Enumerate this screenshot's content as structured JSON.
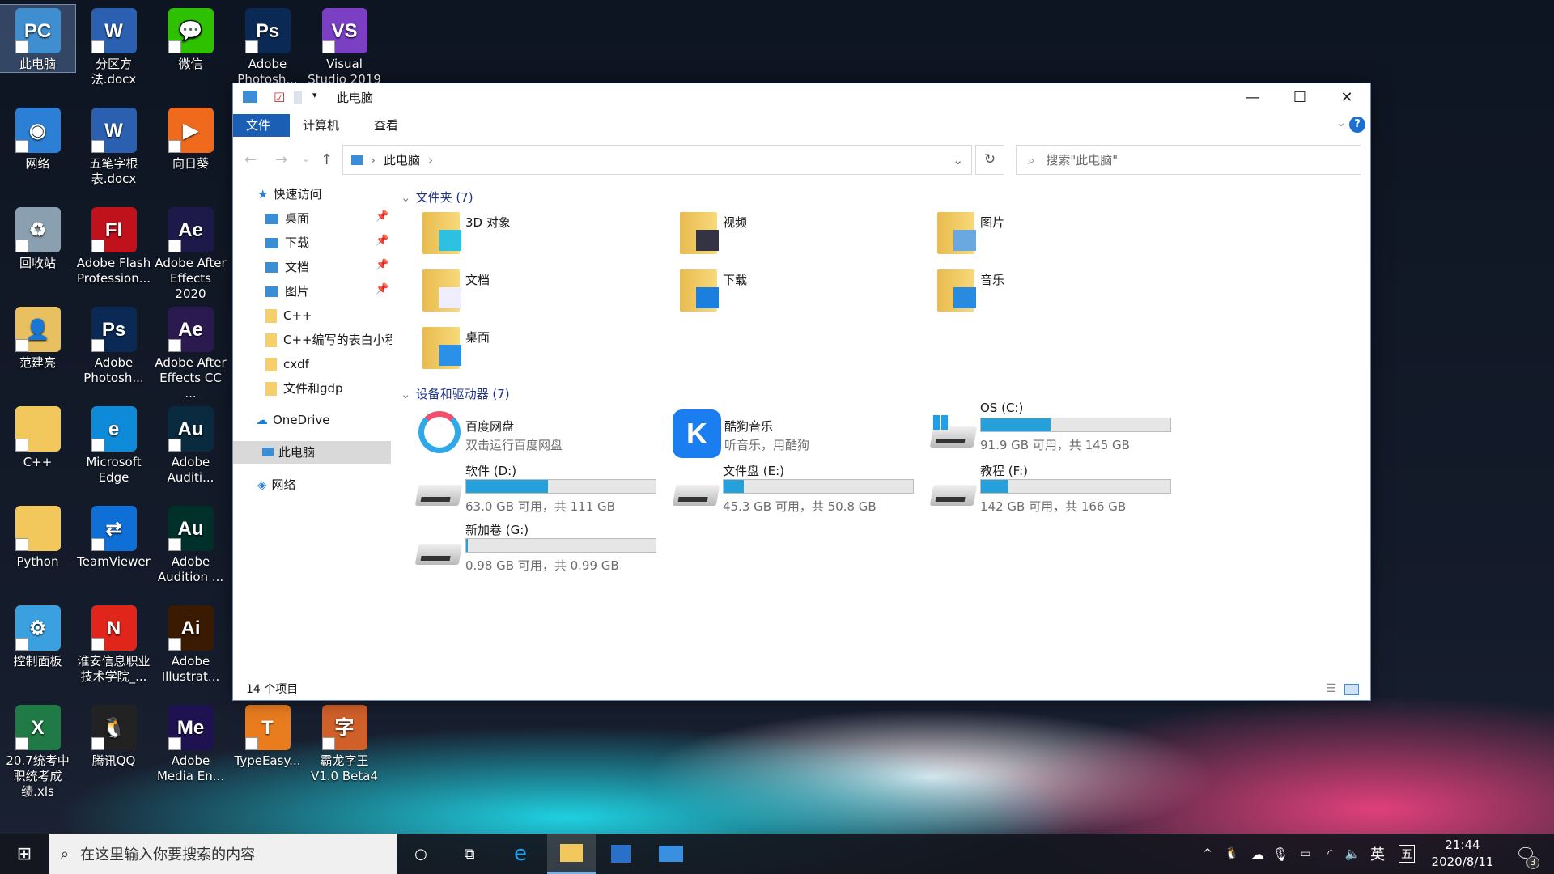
{
  "desktop": {
    "icons": [
      {
        "label": "此电脑",
        "abbr": "PC",
        "color": "#3f8fd0",
        "selected": true
      },
      {
        "label": "网络",
        "abbr": "◉",
        "color": "#2b7fd4"
      },
      {
        "label": "回收站",
        "abbr": "♻",
        "color": "#8aa0b0"
      },
      {
        "label": "范建亮",
        "abbr": "👤",
        "color": "#e8c060"
      },
      {
        "label": "C++",
        "abbr": "",
        "color": "#f2c75c"
      },
      {
        "label": "Python",
        "abbr": "",
        "color": "#f2c75c"
      },
      {
        "label": "控制面板",
        "abbr": "⚙",
        "color": "#3aa0e0"
      },
      {
        "label": "20.7统考中职统考成绩.xls",
        "abbr": "X",
        "color": "#1f7a45"
      },
      {
        "label": "分区方法.docx",
        "abbr": "W",
        "color": "#2b5fb0"
      },
      {
        "label": "五笔字根表.docx",
        "abbr": "W",
        "color": "#2b5fb0"
      },
      {
        "label": "Adobe Flash Profession...",
        "abbr": "Fl",
        "color": "#c0121b"
      },
      {
        "label": "Adobe Photosh...",
        "abbr": "Ps",
        "color": "#0a2a55"
      },
      {
        "label": "Microsoft Edge",
        "abbr": "e",
        "color": "#0d8ad8"
      },
      {
        "label": "TeamViewer",
        "abbr": "⇄",
        "color": "#0e6fd6"
      },
      {
        "label": "淮安信息职业技术学院_...",
        "abbr": "N",
        "color": "#e0251b"
      },
      {
        "label": "腾讯QQ",
        "abbr": "🐧",
        "color": "#222"
      },
      {
        "label": "微信",
        "abbr": "💬",
        "color": "#2dc100"
      },
      {
        "label": "向日葵",
        "abbr": "▶",
        "color": "#f06a1e"
      },
      {
        "label": "Adobe After Effects 2020",
        "abbr": "Ae",
        "color": "#1d1a4a"
      },
      {
        "label": "Adobe After Effects CC ...",
        "abbr": "Ae",
        "color": "#2a1a50"
      },
      {
        "label": "Adobe Auditi...",
        "abbr": "Au",
        "color": "#0a2a40"
      },
      {
        "label": "Adobe Audition ...",
        "abbr": "Au",
        "color": "#00302a"
      },
      {
        "label": "Adobe Illustrat...",
        "abbr": "Ai",
        "color": "#3a1a00"
      },
      {
        "label": "Adobe Media En...",
        "abbr": "Me",
        "color": "#1e1250"
      },
      {
        "label": "Adobe Photosh...",
        "abbr": "Ps",
        "color": "#0a2a55"
      },
      {
        "label": "TypeEasy...",
        "abbr": "T",
        "color": "#e87c1e"
      },
      {
        "label": "Visual Studio 2019",
        "abbr": "VS",
        "color": "#7b3fc4"
      },
      {
        "label": "霸龙字王V1.0 Beta4",
        "abbr": "字",
        "color": "#d0602a"
      }
    ]
  },
  "explorer": {
    "title": "此电脑",
    "ribbon_tabs": [
      "文件",
      "计算机",
      "查看"
    ],
    "address": {
      "path": "此电脑"
    },
    "search": {
      "placeholder": "搜索\"此电脑\""
    },
    "nav": {
      "quick_access": "快速访问",
      "quick_items": [
        {
          "label": "桌面",
          "pinned": true
        },
        {
          "label": "下载",
          "pinned": true
        },
        {
          "label": "文档",
          "pinned": true
        },
        {
          "label": "图片",
          "pinned": true
        },
        {
          "label": "C++"
        },
        {
          "label": "C++编写的表白小程"
        },
        {
          "label": "cxdf"
        },
        {
          "label": "文件和gdp"
        }
      ],
      "onedrive": "OneDrive",
      "this_pc": "此电脑",
      "network": "网络"
    },
    "folders_header": "文件夹 (7)",
    "folders": [
      "3D 对象",
      "视频",
      "图片",
      "文档",
      "下载",
      "音乐",
      "桌面"
    ],
    "devices_header": "设备和驱动器 (7)",
    "apps": [
      {
        "name": "百度网盘",
        "desc": "双击运行百度网盘"
      },
      {
        "name": "酷狗音乐",
        "desc": "听音乐，用酷狗"
      }
    ],
    "drives": [
      {
        "name": "OS (C:)",
        "info": "91.9 GB 可用，共 145 GB",
        "used_pct": 36.6
      },
      {
        "name": "软件 (D:)",
        "info": "63.0 GB 可用，共 111 GB",
        "used_pct": 43.2
      },
      {
        "name": "文件盘 (E:)",
        "info": "45.3 GB 可用，共 50.8 GB",
        "used_pct": 10.8
      },
      {
        "name": "教程 (F:)",
        "info": "142 GB 可用，共 166 GB",
        "used_pct": 14.5
      },
      {
        "name": "新加卷 (G:)",
        "info": "0.98 GB 可用，共 0.99 GB",
        "used_pct": 1
      }
    ],
    "status": "14 个项目"
  },
  "taskbar": {
    "search_placeholder": "在这里输入你要搜索的内容",
    "ime": "英",
    "ime2": "五",
    "time": "21:44",
    "date": "2020/8/11",
    "notifications": "3"
  },
  "colors": {
    "accent": "#1a5fb4",
    "bar": "#26a0da"
  }
}
